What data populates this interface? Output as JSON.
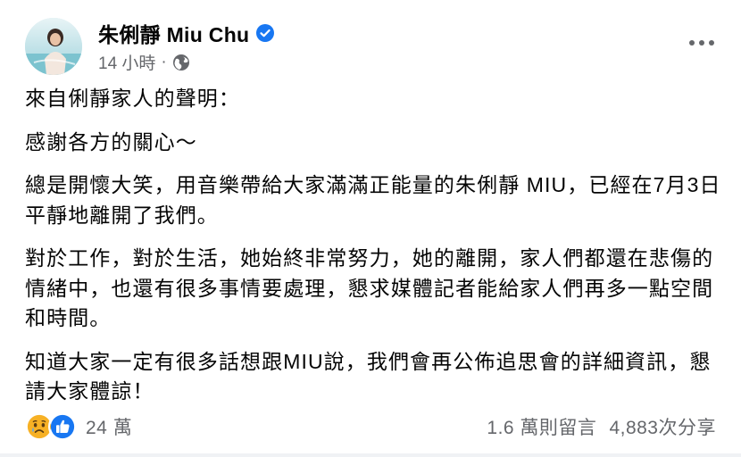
{
  "post": {
    "author": "朱俐靜 Miu Chu",
    "time": "14 小時",
    "separator": "·",
    "paragraphs": [
      "來自俐靜家人的聲明：",
      "感謝各方的關心～",
      "總是開懷大笑，用音樂帶給大家滿滿正能量的朱俐靜 MIU，已經在7月3日平靜地離開了我們。",
      "對於工作，對於生活，她始終非常努力，她的離開，家人們都還在悲傷的情緒中，也還有很多事情要處理，懇求媒體記者能給家人們再多一點空間和時間。",
      "知道大家一定有很多話想跟MIU說，我們會再公佈追思會的詳細資訊，懇請大家體諒！"
    ]
  },
  "footer": {
    "reaction_count": "24 萬",
    "comments": "1.6 萬則留言",
    "shares": "4,883次分享"
  },
  "colors": {
    "verified": "#1877f2",
    "secondary_text": "#65676b",
    "sad": "#f7b125",
    "like": "#1877f2"
  },
  "icons": [
    "verified-badge-icon",
    "globe-icon",
    "more-options-icon",
    "sad-reaction-icon",
    "like-reaction-icon"
  ]
}
